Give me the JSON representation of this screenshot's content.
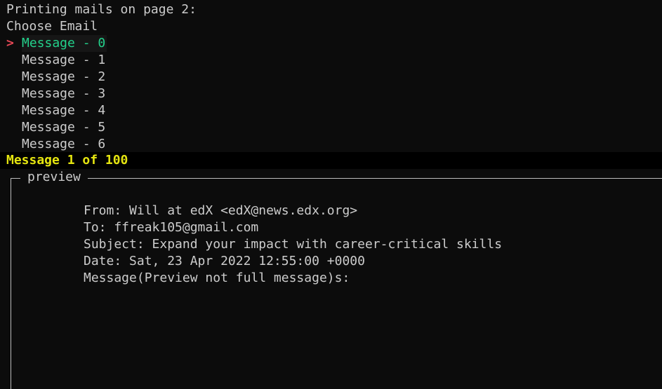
{
  "header": {
    "title": "Printing mails on page 2:",
    "prompt": "Choose Email"
  },
  "menu": {
    "cursor": ">",
    "items": [
      {
        "label": "Message - 0",
        "selected": true
      },
      {
        "label": "Message - 1",
        "selected": false
      },
      {
        "label": "Message - 2",
        "selected": false
      },
      {
        "label": "Message - 3",
        "selected": false
      },
      {
        "label": "Message - 4",
        "selected": false
      },
      {
        "label": "Message - 5",
        "selected": false
      },
      {
        "label": "Message - 6",
        "selected": false
      }
    ]
  },
  "status": {
    "text": "Message 1 of 100"
  },
  "preview": {
    "title": "preview",
    "from": "From: Will at edX <edX@news.edx.org>",
    "to": "To: ffreak105@gmail.com",
    "subject": "Subject: Expand your impact with career-critical skills",
    "date": "Date: Sat, 23 Apr 2022 12:55:00 +0000",
    "message": "Message(Preview not full message)s:"
  },
  "colors": {
    "background": "#0c0c0c",
    "text": "#cccccc",
    "cursor": "#e74856",
    "selected": "#23d18b",
    "status": "#e5e510"
  }
}
